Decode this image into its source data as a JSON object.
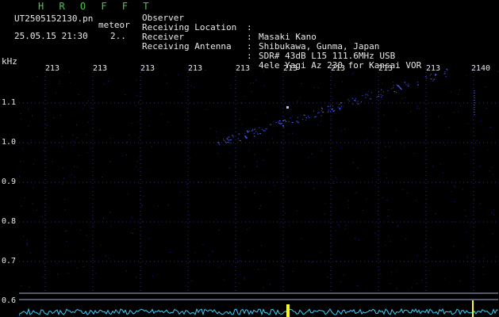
{
  "header": {
    "app_title": "H R O F F T",
    "filename": "UT2505152130.pn",
    "mode": "meteor",
    "datetime": "25.05.15 21:30",
    "counter": "2..",
    "info": [
      {
        "key": "Observer",
        "sep": ":",
        "value": "Masaki Kano"
      },
      {
        "key": "Receiving Location",
        "sep": ":",
        "value": "Shibukawa, Gunma, Japan"
      },
      {
        "key": "Receiver",
        "sep": ":",
        "value": "SDR# 43dB L15 111.6MHz USB"
      },
      {
        "key": "Receiving Antenna",
        "sep": ":",
        "value": "4ele Yagi Az 230 for Kansai VOR"
      }
    ]
  },
  "axes": {
    "y_unit": "kHz",
    "y_ticks": [
      "1.1",
      "1.0",
      "0.9",
      "0.8",
      "0.7",
      "0.6"
    ],
    "x_ticks": [
      "213",
      "213",
      "213",
      "213",
      "213",
      "213",
      "213",
      "213",
      "213",
      "2140"
    ]
  },
  "colors": {
    "background": "#000000",
    "grid": "#2a2a9a",
    "signal": "#4a5cff",
    "title": "#3cd23c",
    "line": "#a8b0d8",
    "noise": "#30d0ff",
    "marker": "#ffff00"
  }
}
